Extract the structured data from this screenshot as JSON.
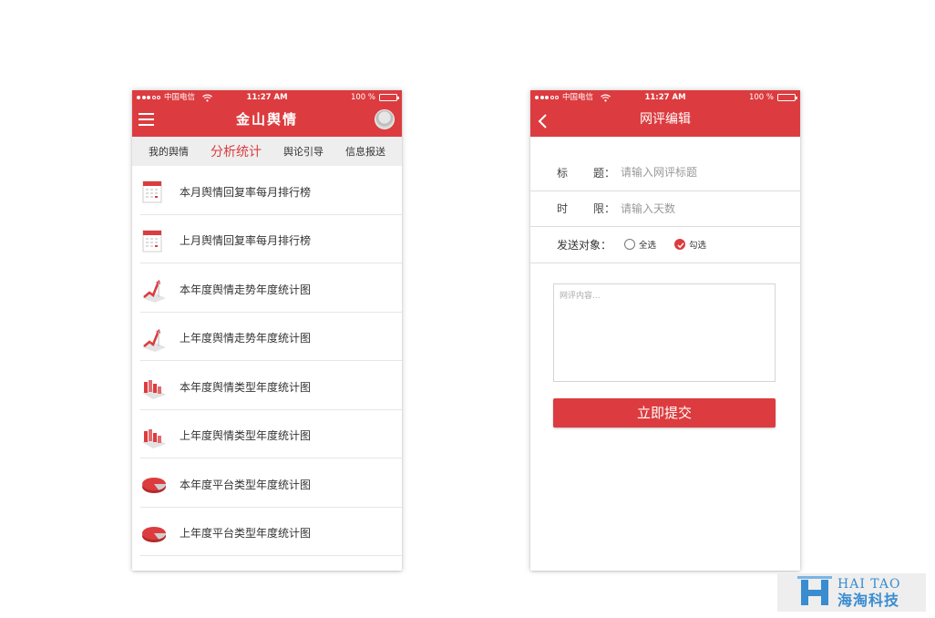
{
  "left_screen": {
    "status": {
      "carrier": "中国电信",
      "time": "11:27 AM",
      "battery": "100 %"
    },
    "title": "金山舆情",
    "tabs": [
      {
        "label": "我的舆情",
        "active": false
      },
      {
        "label": "分析统计",
        "active": true
      },
      {
        "label": "舆论引导",
        "active": false
      },
      {
        "label": "信息报送",
        "active": false
      }
    ],
    "items": [
      {
        "label": "本月舆情回复率每月排行榜",
        "icon": "calendar-icon"
      },
      {
        "label": "上月舆情回复率每月排行榜",
        "icon": "calendar-icon"
      },
      {
        "label": "本年度舆情走势年度统计图",
        "icon": "trend-chart-icon"
      },
      {
        "label": "上年度舆情走势年度统计图",
        "icon": "trend-chart-icon"
      },
      {
        "label": "本年度舆情类型年度统计图",
        "icon": "bar-chart-icon"
      },
      {
        "label": "上年度舆情类型年度统计图",
        "icon": "bar-chart-icon"
      },
      {
        "label": "本年度平台类型年度统计图",
        "icon": "pie-chart-icon"
      },
      {
        "label": "上年度平台类型年度统计图",
        "icon": "pie-chart-icon"
      }
    ]
  },
  "right_screen": {
    "status": {
      "carrier": "中国电信",
      "time": "11:27 AM",
      "battery": "100 %"
    },
    "title": "网评编辑",
    "form": {
      "title_label_a": "标",
      "title_label_b": "题：",
      "title_placeholder": "请输入网评标题",
      "limit_label_a": "时",
      "limit_label_b": "限：",
      "limit_placeholder": "请输入天数",
      "target_label": "发送对象：",
      "option_all": "全选",
      "option_select": "勾选",
      "selected_option": "勾选",
      "content_placeholder": "网评内容...",
      "submit_label": "立即提交"
    }
  },
  "watermark": {
    "en": "HAI TAO",
    "cn": "海淘科技"
  },
  "colors": {
    "accent": "#dc3c3f",
    "tab_bg": "#eeeeee",
    "watermark": "#3a8cd0"
  }
}
